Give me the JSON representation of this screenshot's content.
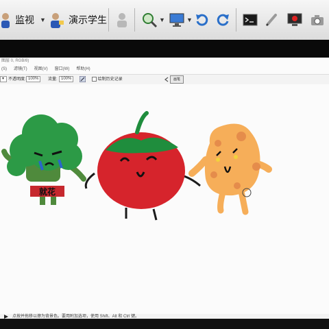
{
  "toolbar": {
    "monitor_label": "监视",
    "demo_student_label": "演示学生"
  },
  "photoshop": {
    "title": "图层 0, RGB/8)",
    "menu": [
      "(S)",
      "滤镜(T)",
      "视图(V)",
      "窗口(W)",
      "帮助(H)"
    ],
    "opacity_label": "不透明度:",
    "opacity_value": "100%",
    "flow_label": "流量:",
    "flow_value": "100%",
    "history_label": "绘制历史记录",
    "panel_tab": "画笔",
    "status_text": "点按并拖移以擦为背景色。要用附加选项，使用 Shift、Alt 和 Ctrl 键。"
  },
  "drawing": {
    "broccoli_text": "就花"
  },
  "colors": {
    "broccoli_green": "#2c9a46",
    "broccoli_body": "#4f8a3c",
    "tomato_red": "#d6242c",
    "tomato_leaf": "#1f8d3d",
    "potato": "#f6ae59",
    "potato_spot": "#e58c4b"
  }
}
